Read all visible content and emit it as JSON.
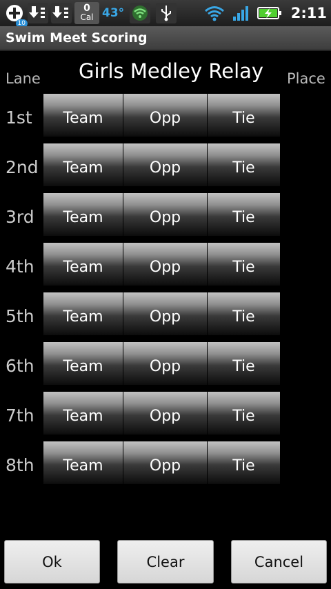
{
  "status_bar": {
    "notification_badge": "10",
    "calendar_count": "0",
    "calendar_label": "Cal",
    "temperature": "43°",
    "time": "2:11"
  },
  "app": {
    "title": "Swim Meet Scoring"
  },
  "header": {
    "lane_label": "Lane",
    "event_title": "Girls Medley Relay",
    "place_label": "Place"
  },
  "rows": [
    {
      "lane": "1st",
      "team": "Team",
      "opp": "Opp",
      "tie": "Tie"
    },
    {
      "lane": "2nd",
      "team": "Team",
      "opp": "Opp",
      "tie": "Tie"
    },
    {
      "lane": "3rd",
      "team": "Team",
      "opp": "Opp",
      "tie": "Tie"
    },
    {
      "lane": "4th",
      "team": "Team",
      "opp": "Opp",
      "tie": "Tie"
    },
    {
      "lane": "5th",
      "team": "Team",
      "opp": "Opp",
      "tie": "Tie"
    },
    {
      "lane": "6th",
      "team": "Team",
      "opp": "Opp",
      "tie": "Tie"
    },
    {
      "lane": "7th",
      "team": "Team",
      "opp": "Opp",
      "tie": "Tie"
    },
    {
      "lane": "8th",
      "team": "Team",
      "opp": "Opp",
      "tie": "Tie"
    }
  ],
  "buttons": {
    "ok": "Ok",
    "clear": "Clear",
    "cancel": "Cancel"
  }
}
